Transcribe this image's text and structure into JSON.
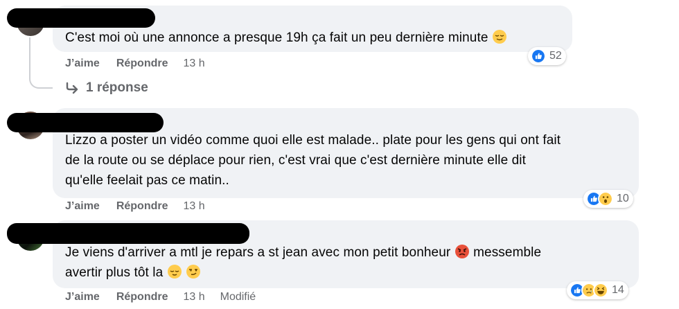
{
  "comments": [
    {
      "text": "C'est moi où une annonce a presque 19h ça fait un peu dernière minute",
      "like_label": "J’aime",
      "reply_label": "Répondre",
      "time": "13 h",
      "reaction_count": "52",
      "reactions": [
        "like-icon"
      ]
    },
    {
      "text_lines": [
        "Lizzo a poster un vidéo comme quoi elle est malade.. plate pour les gens qui ont fait",
        "de la route ou se déplace pour rien, c'est vrai que c'est dernière minute elle dit",
        "qu'elle feelait pas ce matin.."
      ],
      "like_label": "J’aime",
      "reply_label": "Répondre",
      "time": "13 h",
      "reaction_count": "10",
      "reactions": [
        "like-icon",
        "wow-icon"
      ]
    },
    {
      "text_line1": "Je viens d'arriver a mtl je repars a st jean avec mon petit bonheur",
      "text_line1_end": "messemble",
      "text_line2": "avertir plus tôt la",
      "like_label": "J’aime",
      "reply_label": "Répondre",
      "time": "13 h",
      "edited_label": "Modifié",
      "reaction_count": "14",
      "reactions": [
        "like-icon",
        "sad-icon",
        "haha-icon"
      ]
    }
  ],
  "replies_link": "1 réponse",
  "colors": {
    "bubble": "#f0f2f5",
    "like_blue": "#1877f2",
    "secondary_text": "#65676b",
    "emoji_yellow": "#ffcc4d"
  }
}
